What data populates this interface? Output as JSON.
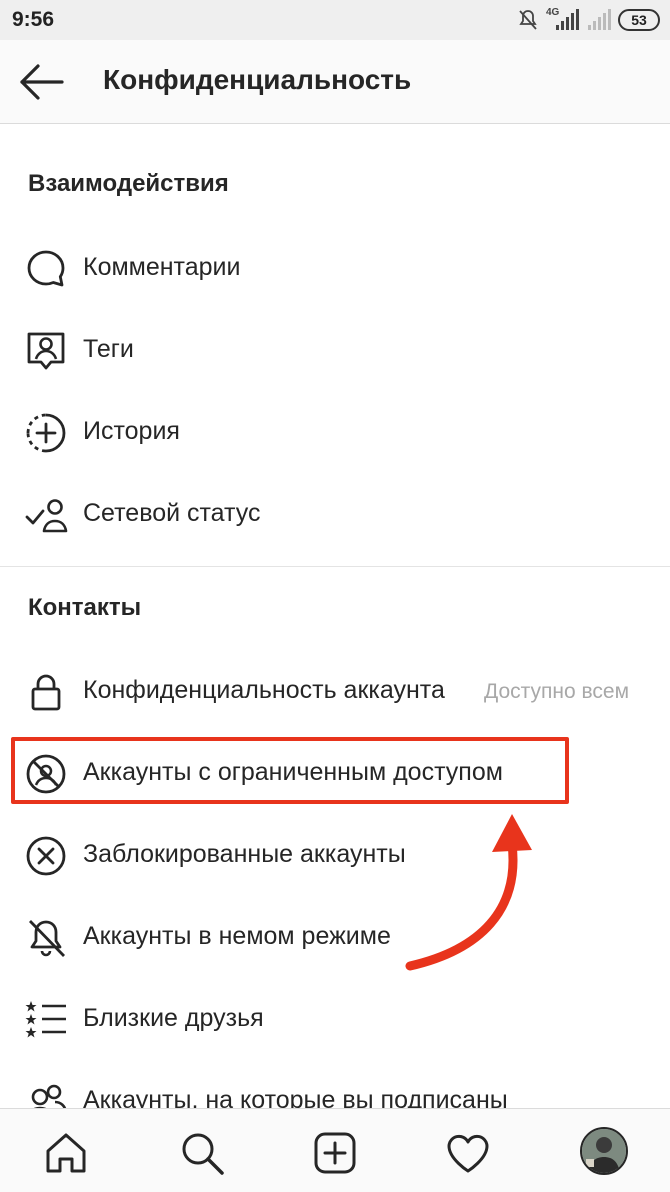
{
  "status_bar": {
    "time": "9:56",
    "network": "4G",
    "battery": "53"
  },
  "header": {
    "title": "Конфиденциальность"
  },
  "sections": {
    "interactions": {
      "title": "Взаимодействия",
      "items": [
        {
          "label": "Комментарии",
          "icon": "comment-icon"
        },
        {
          "label": "Теги",
          "icon": "tag-person-icon"
        },
        {
          "label": "История",
          "icon": "story-add-icon"
        },
        {
          "label": "Сетевой статус",
          "icon": "activity-status-icon"
        }
      ]
    },
    "contacts": {
      "title": "Контакты",
      "items": [
        {
          "label": "Конфиденциальность аккаунта",
          "value": "Доступно всем",
          "icon": "lock-icon"
        },
        {
          "label": "Аккаунты с ограниченным доступом",
          "icon": "restricted-icon"
        },
        {
          "label": "Заблокированные аккаунты",
          "icon": "blocked-icon"
        },
        {
          "label": "Аккаунты в немом режиме",
          "icon": "muted-bell-icon"
        },
        {
          "label": "Близкие друзья",
          "icon": "close-friends-list-icon"
        },
        {
          "label": "Аккаунты, на которые вы подписаны",
          "icon": "following-icon"
        }
      ]
    }
  },
  "bottom_nav": [
    {
      "icon": "home-icon"
    },
    {
      "icon": "search-icon"
    },
    {
      "icon": "add-post-icon"
    },
    {
      "icon": "heart-icon"
    },
    {
      "icon": "profile-avatar"
    }
  ],
  "colors": {
    "highlight": "#e8341c",
    "text": "#262626",
    "secondary_text": "#a8a8a8"
  }
}
